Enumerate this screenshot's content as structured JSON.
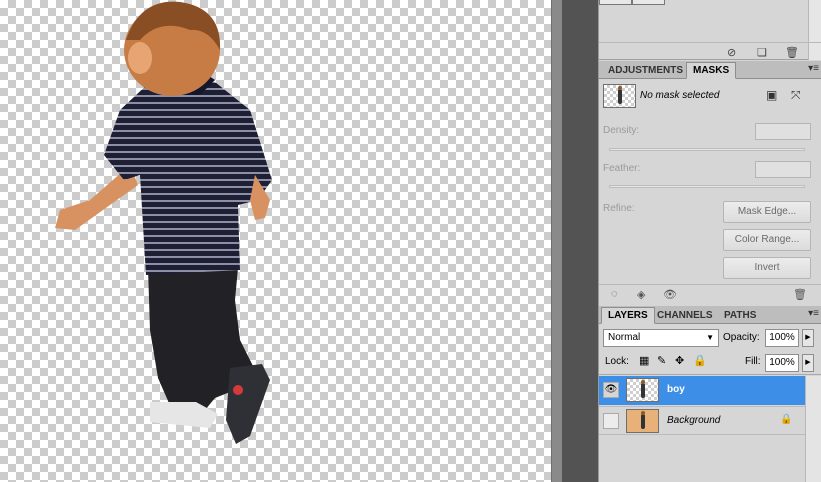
{
  "masks_panel": {
    "tab_adjustments": "ADJUSTMENTS",
    "tab_masks": "MASKS",
    "status": "No mask selected",
    "density_label": "Density:",
    "feather_label": "Feather:",
    "refine_label": "Refine:",
    "mask_edge_button": "Mask Edge...",
    "color_range_button": "Color Range...",
    "invert_button": "Invert"
  },
  "layers_panel": {
    "tab_layers": "LAYERS",
    "tab_channels": "CHANNELS",
    "tab_paths": "PATHS",
    "blend_mode": "Normal",
    "opacity_label": "Opacity:",
    "opacity_value": "100%",
    "lock_label": "Lock:",
    "fill_label": "Fill:",
    "fill_value": "100%",
    "layers": [
      {
        "name": "boy",
        "selected": true,
        "visible": true
      },
      {
        "name": "Background",
        "selected": false,
        "visible": false,
        "locked": true
      }
    ]
  },
  "colors": {
    "selection": "#3d8ee6",
    "gutter": "#535353",
    "panel_bg": "#d6d6d6"
  }
}
